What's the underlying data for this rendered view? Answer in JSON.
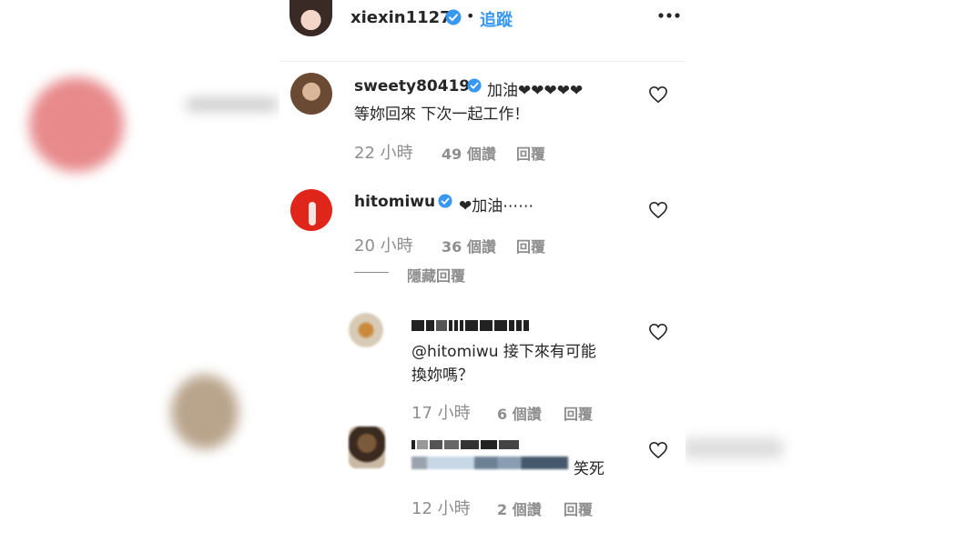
{
  "colors": {
    "verified": "#3897f0",
    "link": "#003569",
    "muted": "#8e8e8e",
    "text": "#262626"
  },
  "header": {
    "username": "xiexin1127",
    "separator": "•",
    "follow_label": "追蹤",
    "more_icon": "more-dots-icon"
  },
  "comments": [
    {
      "username": "sweety80419",
      "verified": true,
      "text_line1": "加油❤❤❤❤❤",
      "text_line2": "等妳回來 下次一起工作！",
      "time": "22 小時",
      "likes": "49 個讚",
      "reply": "回覆"
    },
    {
      "username": "hitomiwu",
      "verified": true,
      "text_line1": "❤加油⋯⋯",
      "time": "20 小時",
      "likes": "36 個讚",
      "reply": "回覆",
      "hide_replies": "隱藏回覆"
    }
  ],
  "replies": [
    {
      "mention": "@hitomiwu",
      "text_line1": " 接下來有可能",
      "text_line2": "換妳嗎？",
      "time": "17 小時",
      "likes": "6 個讚",
      "reply": "回覆"
    },
    {
      "text_line1": "笑死",
      "time": "12 小時",
      "likes": "2 個讚",
      "reply": "回覆"
    }
  ]
}
